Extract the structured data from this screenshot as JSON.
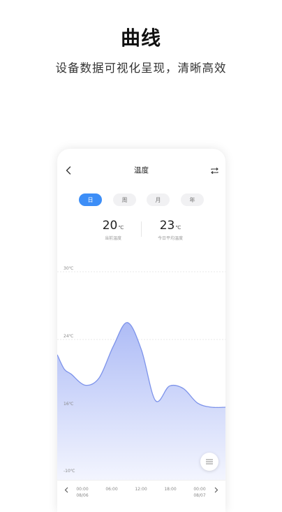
{
  "promo": {
    "title": "曲线",
    "subtitle": "设备数据可视化呈现，清晰高效"
  },
  "header": {
    "back_icon": "chevron-left-icon",
    "title": "温度",
    "action_icon": "repeat-icon"
  },
  "tabs": [
    {
      "label": "日",
      "active": true
    },
    {
      "label": "周",
      "active": false
    },
    {
      "label": "月",
      "active": false
    },
    {
      "label": "年",
      "active": false
    }
  ],
  "stats": {
    "current": {
      "value": "20",
      "unit": "℃",
      "label": "当前温度"
    },
    "average": {
      "value": "23",
      "unit": "℃",
      "label": "今日平均温度"
    }
  },
  "colors": {
    "accent": "#3d8ef7",
    "line": "#7d93ea",
    "fill_top": "#aebcf6",
    "fill_bottom": "#f3f5fe"
  },
  "chart_data": {
    "type": "area",
    "y_ticks": [
      "30℃",
      "24℃",
      "16℃",
      "-10℃"
    ],
    "ylim": [
      -10,
      30
    ],
    "x_ticks": [
      {
        "time": "00:00",
        "date": "08/06"
      },
      {
        "time": "06:00",
        "date": ""
      },
      {
        "time": "12:00",
        "date": ""
      },
      {
        "time": "18:00",
        "date": ""
      },
      {
        "time": "00:00",
        "date": "08/07"
      }
    ],
    "x": [
      0,
      1,
      2,
      4,
      6,
      8,
      10,
      12,
      14,
      16,
      18,
      20,
      22,
      24
    ],
    "values": [
      22.2,
      20.5,
      19.9,
      18.6,
      19.5,
      23.2,
      25.5,
      22.8,
      16.8,
      18.5,
      18.2,
      16.5,
      16.0,
      16.0
    ]
  },
  "fab_icon": "menu-lines-icon"
}
